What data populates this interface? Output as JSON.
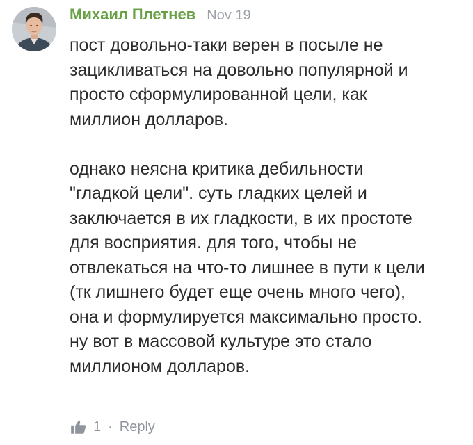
{
  "comment": {
    "author": "Михаил Плетнев",
    "date": "Nov 19",
    "paragraphs": [
      {
        "lines": [
          "пост довольно-таки верен в посыле не",
          "зацикливаться на довольно популярной и",
          "просто сформулированной цели, как",
          "миллион долларов."
        ]
      },
      {
        "lines": [
          "однако неясна критика дебильности",
          "\"гладкой цели\". суть гладких целей и",
          "заключается в их гладкости, в их простоте",
          "для восприятия. для того, чтобы не",
          "отвлекаться на что-то лишнее в пути к цели",
          "(тк лишнего будет еще очень много чего),",
          "она и формулируется максимально просто.",
          "ну вот в массовой культуре это стало",
          "миллионом долларов."
        ]
      }
    ],
    "footer": {
      "like_icon": "thumbs-up-icon",
      "like_count": "1",
      "separator": "·",
      "reply_label": "Reply"
    },
    "colors": {
      "author": "#68a045",
      "meta": "#9aa0a6",
      "text": "#2b2b2b"
    }
  }
}
